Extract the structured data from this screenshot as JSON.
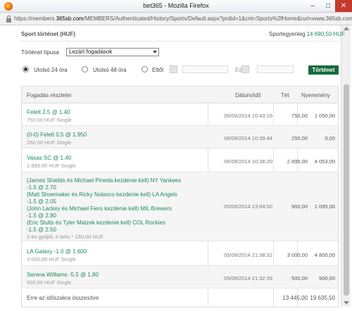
{
  "window": {
    "title": "bet365 - Mozilla Firefox",
    "url_prefix": "https://members.",
    "url_domain": "365sb.com",
    "url_rest": "/MEMBERS/Authenticated/History/Sports/Default.aspx?prdid=1&cnt=Sports%2fHome&rurl=www.365sb.com"
  },
  "header": {
    "title": "Sport történet (HUF)",
    "balance_label": "Sportegyenleg",
    "balance_value": "14 690,50 HUF"
  },
  "filters": {
    "type_label": "Történet típusa",
    "type_value": "Lezárt fogadások",
    "radio_24h": "Utolsó 24 óra",
    "radio_48h": "Utolsó 48 óra",
    "radio_from": "Ettől",
    "until_label": "Eddig",
    "submit": "Történet"
  },
  "table": {
    "headers": [
      "Fogadás részletei",
      "Dátum/idő",
      "Tét",
      "Nyeremény"
    ],
    "rows": [
      {
        "lines": [
          "Felett  2.5 @ 1.40"
        ],
        "sub": "750.00 HUF  Single",
        "date": "06/09/2014 10:43:16",
        "stake": "750,00",
        "return": "1 050,00"
      },
      {
        "lines": [
          "(0-0) Felett  0.5 @ 1.950"
        ],
        "sub": "250.00 HUF  Single",
        "date": "06/09/2014 10:39:44",
        "stake": "250,00",
        "return": "0,00"
      },
      {
        "lines": [
          "Vasas SC @ 1.40"
        ],
        "sub": "2 895.00 HUF  Single",
        "date": "06/09/2014 10:38:20",
        "stake": "2 895,00",
        "return": "4 053,00"
      },
      {
        "lines": [
          "(James Shields és Michael Pineda kezdenie kell) NY Yankees",
          " -1.5 @ 2.70",
          "(Matt Shoemaker és Ricky Nolasco kezdenie kell) LA Angels",
          " -1.5 @ 2.05",
          "(John Lackey és Michael Fiers kezdenie kell) MIL Brewers",
          " -1.5 @ 2.80",
          "(Eric Stults és Tyler Matzek kezdenie kell) COL Rockies",
          " -1.5 @ 2.50"
        ],
        "sub": "2-es gyűjtő, 6  bets  * 150,00 HUF",
        "date": "05/09/2014 23:04:50",
        "stake": "900,00",
        "return": "1 095,00"
      },
      {
        "lines": [
          "LA Galaxy  -1.0 @ 1.600"
        ],
        "sub": "3 000,00 HUF  Single",
        "date": "05/09/2014 21:38:32",
        "stake": "3 000,00",
        "return": "4 800,00"
      },
      {
        "lines": [
          "Serena Williams  -5.5 @ 1.80"
        ],
        "sub": "500.00 HUF  Single",
        "date": "05/09/2014 21:32:39",
        "stake": "500,00",
        "return": "900,00"
      }
    ],
    "footer": {
      "label": "Erre az időszakra összesítve",
      "stake_total": "13 445,00",
      "return_total": "19 635,50"
    }
  }
}
